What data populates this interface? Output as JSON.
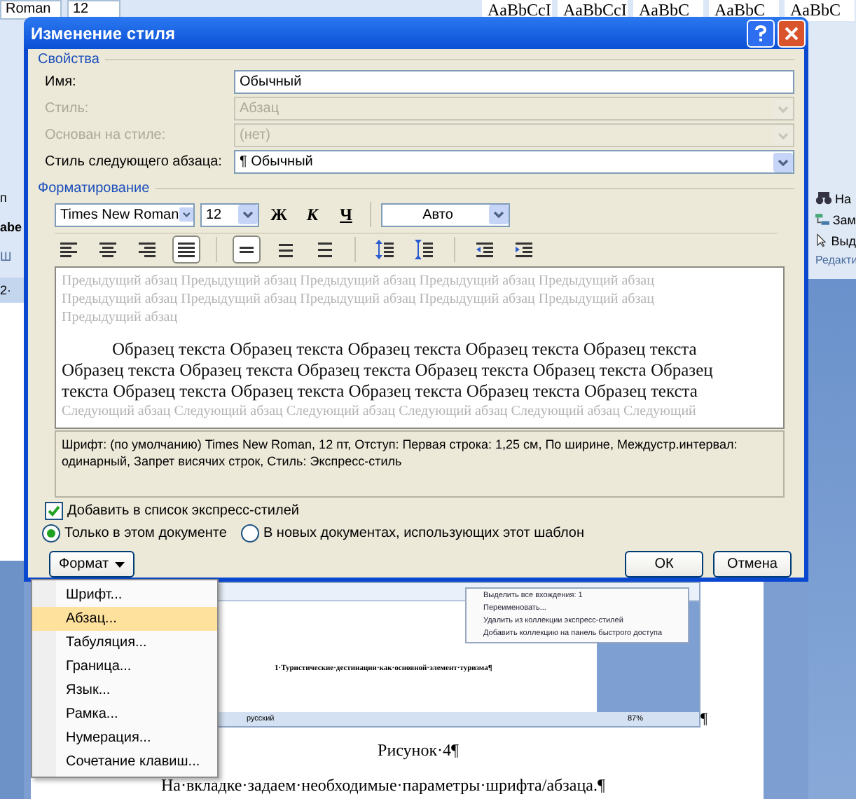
{
  "background_app": {
    "font_box": "Roman",
    "size_box": "12",
    "style_gallery": [
      "AaBbCcI",
      "AaBbCcI",
      "AaBbC",
      "AaBbC",
      "AaBbC"
    ],
    "left_items": [
      "п",
      "abe",
      "Ш",
      "2·"
    ],
    "right_items": [
      {
        "kind": "find",
        "label": "На"
      },
      {
        "kind": "replace",
        "label": "Зам"
      },
      {
        "kind": "select",
        "label": "Выд"
      }
    ],
    "right_group": "Редакти"
  },
  "document": {
    "embedded_screenshot": {
      "menu": [
        "Выделить все вхождения: 1",
        "Переименовать...",
        "Удалить из коллекции экспресс-стилей",
        "Добавить коллекцию на панель быстрого доступа"
      ],
      "heading": "1·Туристические·дестинации·как·основной·элемент·туризма¶",
      "language": "русский",
      "zoom": "87%"
    },
    "end_mark": "¶",
    "caption": "Рисунок·4¶",
    "paragraph": "На·вкладке·задаем·необходимые·параметры·шрифта/абзаца.¶"
  },
  "dialog": {
    "title": "Изменение стиля",
    "properties": {
      "heading": "Свойства",
      "fields": [
        {
          "label": "Имя:",
          "value": "Обычный",
          "kind": "text",
          "disabled": false
        },
        {
          "label": "Стиль:",
          "value": "Абзац",
          "kind": "select",
          "disabled": true
        },
        {
          "label": "Основан на стиле:",
          "value": "(нет)",
          "kind": "select",
          "disabled": true
        },
        {
          "label": "Стиль следующего абзаца:",
          "value": "¶ Обычный",
          "kind": "select",
          "disabled": false
        }
      ]
    },
    "formatting": {
      "heading": "Форматирование",
      "font": "Times New Roman",
      "size": "12",
      "bold": "Ж",
      "italic": "К",
      "underline": "Ч",
      "text_color_box": "Авто",
      "paragraph_tools": [
        {
          "kind": "align_left",
          "selected": false
        },
        {
          "kind": "align_center",
          "selected": false
        },
        {
          "kind": "align_right",
          "selected": false
        },
        {
          "kind": "justify",
          "selected": true
        },
        {
          "kind": "spacing_single",
          "selected": true
        },
        {
          "kind": "spacing_one_half",
          "selected": false
        },
        {
          "kind": "spacing_double",
          "selected": false
        },
        {
          "kind": "space_increase",
          "selected": false
        },
        {
          "kind": "space_decrease",
          "selected": false
        },
        {
          "kind": "indent_decrease",
          "selected": false
        },
        {
          "kind": "indent_increase",
          "selected": false
        }
      ]
    },
    "preview": {
      "previous": "Предыдущий абзац Предыдущий абзац Предыдущий абзац Предыдущий абзац Предыдущий абзац Предыдущий абзац Предыдущий абзац Предыдущий абзац Предыдущий абзац Предыдущий абзац Предыдущий абзац",
      "sample": "Образец текста Образец текста Образец текста Образец текста Образец текста Образец текста Образец текста Образец текста Образец текста Образец текста Образец текста Образец текста Образец текста Образец текста Образец текста Образец текста",
      "next": "Следующий абзац Следующий абзац Следующий абзац Следующий абзац Следующий абзац Следующий"
    },
    "description": "Шрифт: (по умолчанию) Times New Roman, 12 пт, Отступ: Первая строка:  1,25 см, По ширине, Междустр.интервал:  одинарный, Запрет висячих строк, Стиль: Экспресс-стиль",
    "add_to_quick_styles": {
      "label": "Добавить в список экспресс-стилей",
      "checked": true
    },
    "scope": [
      {
        "label": "Только в этом документе",
        "selected": true
      },
      {
        "label": "В новых документах, использующих этот шаблон",
        "selected": false
      }
    ],
    "format_button": "Формат",
    "ok": "ОК",
    "cancel": "Отмена"
  },
  "format_menu": [
    {
      "label": "Шрифт...",
      "selected": false
    },
    {
      "label": "Абзац...",
      "selected": true
    },
    {
      "label": "Табуляция...",
      "selected": false
    },
    {
      "label": "Граница...",
      "selected": false
    },
    {
      "label": "Язык...",
      "selected": false
    },
    {
      "label": "Рамка...",
      "selected": false
    },
    {
      "label": "Нумерация...",
      "selected": false
    },
    {
      "label": "Сочетание клавиш...",
      "selected": false
    }
  ]
}
